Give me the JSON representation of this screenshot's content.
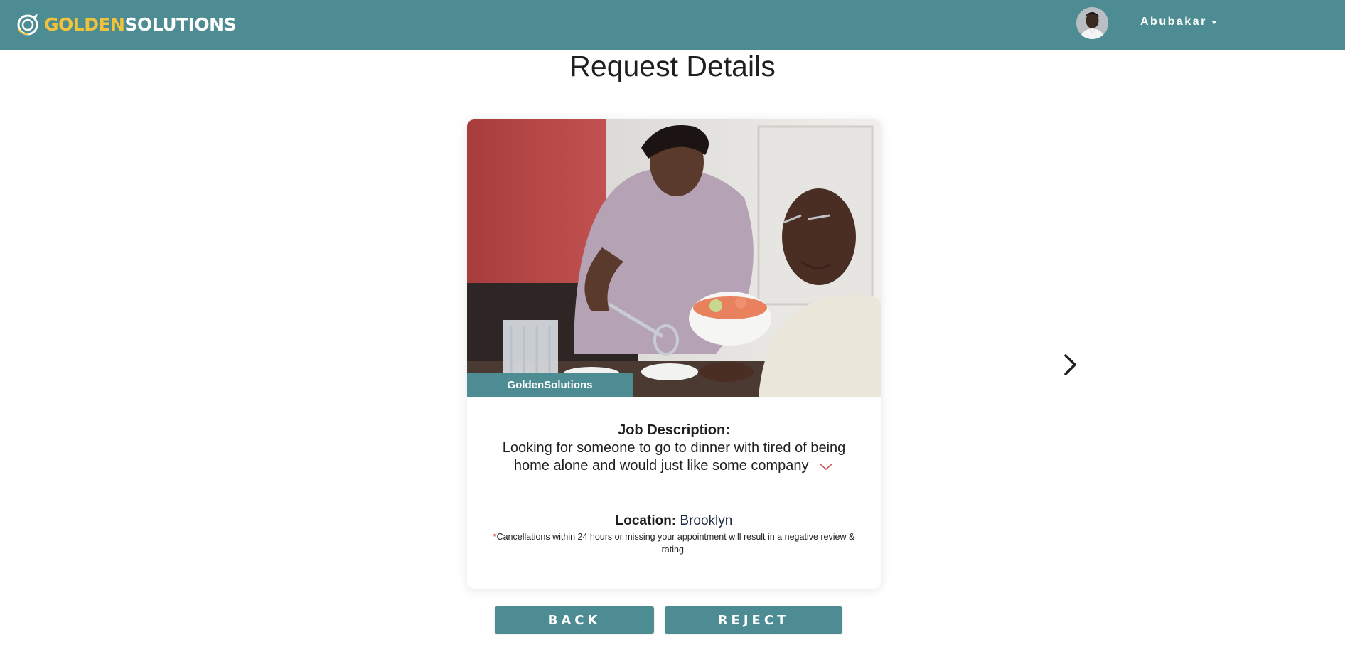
{
  "header": {
    "logo_part1": "GOLDEN",
    "logo_part2": "SOLUTIONS",
    "user_name": "Abubakar",
    "brand_color": "#4c8c92",
    "logo_accent_color": "#f2c33a"
  },
  "page": {
    "title": "Request Details"
  },
  "request": {
    "image_tag": "GoldenSolutions",
    "job_description_label": "Job Description:",
    "job_description": "Looking for someone to go to dinner with tired of being home alone and would just like some company",
    "location_label": "Location:",
    "location_value": "Brooklyn",
    "cancellation_asterisk": "*",
    "cancellation_note": "Cancellations within 24 hours or missing your appointment will result in a negative review & rating."
  },
  "icons": {
    "expand": "chevron-down-icon",
    "next": "chevron-right-icon",
    "logo": "logo-mark-icon"
  },
  "actions": {
    "back_label": "BACK",
    "reject_label": "REJECT"
  }
}
